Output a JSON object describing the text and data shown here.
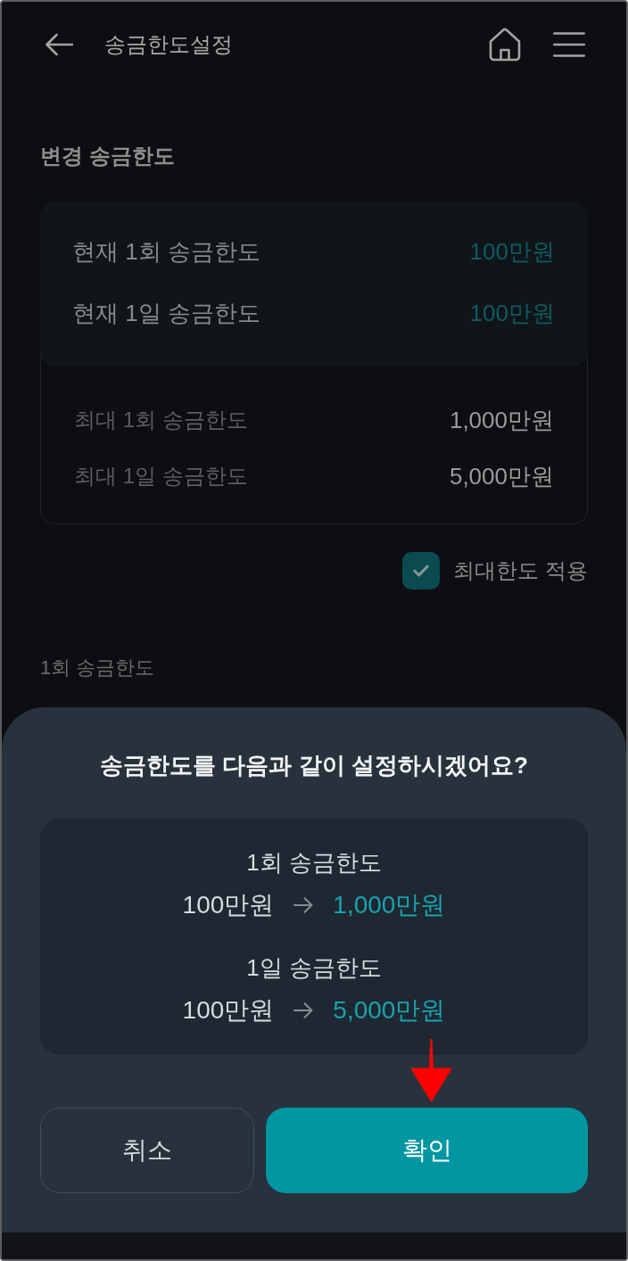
{
  "header": {
    "title": "송금한도설정"
  },
  "section_title": "변경 송금한도",
  "current_limits": [
    {
      "label": "현재 1회 송금한도",
      "value": "100만원"
    },
    {
      "label": "현재 1일 송금한도",
      "value": "100만원"
    }
  ],
  "max_limits": [
    {
      "label": "최대 1회 송금한도",
      "value": "1,000만원"
    },
    {
      "label": "최대 1일 송금한도",
      "value": "5,000만원"
    }
  ],
  "max_limit_option": {
    "label": "최대한도 적용",
    "checked": true
  },
  "field_label": "1회 송금한도",
  "dialog": {
    "title": "송금한도를 다음과 같이 설정하시겠어요?",
    "changes": [
      {
        "label": "1회 송금한도",
        "from": "100만원",
        "to": "1,000만원"
      },
      {
        "label": "1일 송금한도",
        "from": "100만원",
        "to": "5,000만원"
      }
    ],
    "buttons": [
      {
        "label": "취소",
        "kind": "secondary"
      },
      {
        "label": "확인",
        "kind": "primary"
      }
    ]
  }
}
